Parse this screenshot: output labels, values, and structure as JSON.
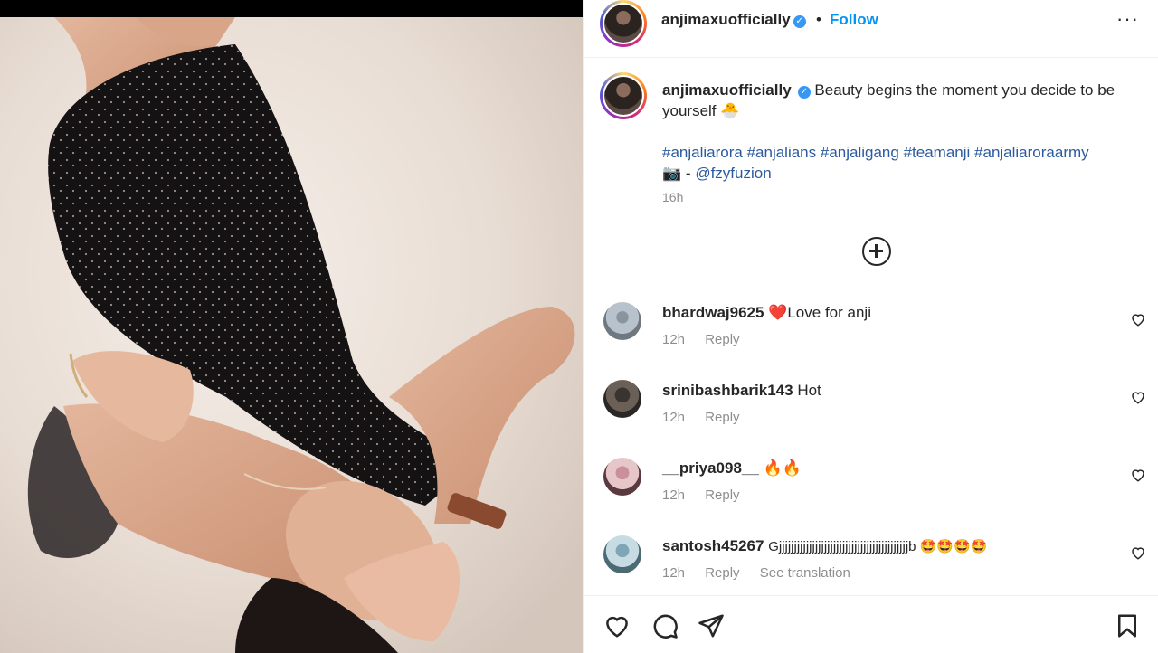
{
  "post": {
    "author": "anjimaxuofficially",
    "follow_label": "Follow",
    "separator": "•",
    "more_label": "···"
  },
  "caption": {
    "author": "anjimaxuofficially",
    "text": "Beauty begins the moment you decide to be yourself",
    "text_emoji": "🐣",
    "hashtags": [
      "#anjaliarora",
      "#anjalians",
      "#anjaligang",
      "#teamanji",
      "#anjaliaroraarmy"
    ],
    "credit_emoji": "📷",
    "credit_sep": "-",
    "credit_mention": "@fzyfuzion",
    "time": "16h"
  },
  "comments": [
    {
      "user": "bhardwaj9625",
      "text": "❤️Love for anji",
      "time": "12h",
      "reply": "Reply",
      "translate": ""
    },
    {
      "user": "srinibashbarik143",
      "text": "Hot",
      "time": "12h",
      "reply": "Reply",
      "translate": ""
    },
    {
      "user": "__priya098__",
      "text": "🔥🔥",
      "time": "12h",
      "reply": "Reply",
      "translate": ""
    },
    {
      "user": "santosh45267",
      "text": "Gjjjjjjjjjjjjjjjjjjjjjjjjjjjjjjjjjjjjjjjjjjjb 🤩🤩🤩🤩",
      "time": "12h",
      "reply": "Reply",
      "translate": "See translation"
    }
  ],
  "colors": {
    "accent_blue": "#0095f6",
    "hashtag": "#2c5aa0",
    "muted": "#8e8e8e",
    "text": "#262626"
  },
  "icons": [
    "more-options-icon",
    "verified-badge-icon",
    "add-circle-icon",
    "heart-icon",
    "comment-icon",
    "share-icon",
    "bookmark-icon"
  ]
}
